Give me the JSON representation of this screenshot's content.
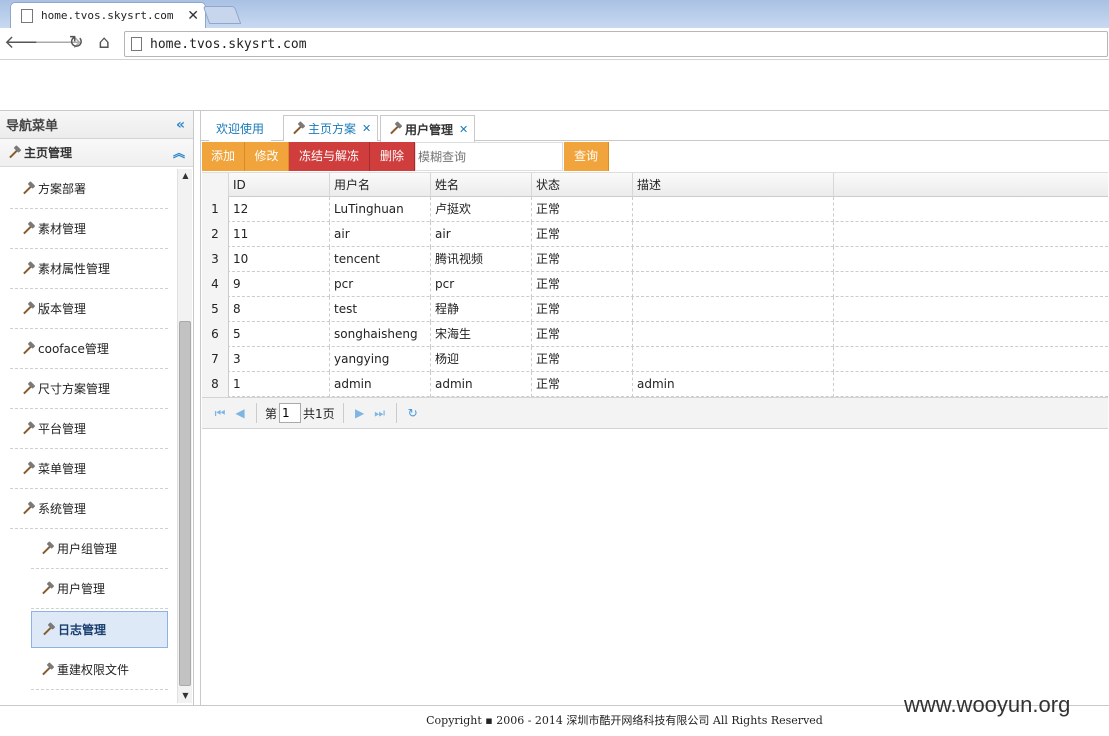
{
  "browser": {
    "tab_title": "home.tvos.skysrt.com",
    "url": "home.tvos.skysrt.com"
  },
  "sidebar": {
    "title": "导航菜单",
    "group": "主页管理",
    "items": [
      {
        "label": "方案部署"
      },
      {
        "label": "素材管理"
      },
      {
        "label": "素材属性管理"
      },
      {
        "label": "版本管理"
      },
      {
        "label": "cooface管理"
      },
      {
        "label": "尺寸方案管理"
      },
      {
        "label": "平台管理"
      },
      {
        "label": "菜单管理"
      },
      {
        "label": "系统管理"
      }
    ],
    "subitems": [
      {
        "label": "用户组管理"
      },
      {
        "label": "用户管理"
      },
      {
        "label": "日志管理"
      },
      {
        "label": "重建权限文件"
      }
    ],
    "active_subitem": "日志管理"
  },
  "content_tabs": [
    {
      "label": "欢迎使用",
      "closable": false
    },
    {
      "label": "主页方案",
      "closable": true
    },
    {
      "label": "用户管理",
      "closable": true,
      "selected": true
    }
  ],
  "toolbar": {
    "add": "添加",
    "edit": "修改",
    "freeze": "冻结与解冻",
    "delete": "删除",
    "search_placeholder": "模糊查询",
    "query": "查询"
  },
  "grid": {
    "columns": [
      "ID",
      "用户名",
      "姓名",
      "状态",
      "描述"
    ],
    "rows": [
      {
        "rn": "1",
        "id": "12",
        "username": "LuTinghuan",
        "name": "卢挺欢",
        "status": "正常",
        "desc": ""
      },
      {
        "rn": "2",
        "id": "11",
        "username": "air",
        "name": "air",
        "status": "正常",
        "desc": ""
      },
      {
        "rn": "3",
        "id": "10",
        "username": "tencent",
        "name": "腾讯视频",
        "status": "正常",
        "desc": ""
      },
      {
        "rn": "4",
        "id": "9",
        "username": "pcr",
        "name": "pcr",
        "status": "正常",
        "desc": ""
      },
      {
        "rn": "5",
        "id": "8",
        "username": "test",
        "name": "程静",
        "status": "正常",
        "desc": ""
      },
      {
        "rn": "6",
        "id": "5",
        "username": "songhaisheng",
        "name": "宋海生",
        "status": "正常",
        "desc": ""
      },
      {
        "rn": "7",
        "id": "3",
        "username": "yangying",
        "name": "杨迎",
        "status": "正常",
        "desc": ""
      },
      {
        "rn": "8",
        "id": "1",
        "username": "admin",
        "name": "admin",
        "status": "正常",
        "desc": "admin"
      }
    ]
  },
  "pager": {
    "page_prefix": "第",
    "page": "1",
    "total": "共1页"
  },
  "footer": "Copyright ▪ 2006 - 2014 深圳市酷开网络科技有限公司 All Rights Reserved",
  "watermark": "www.wooyun.org"
}
